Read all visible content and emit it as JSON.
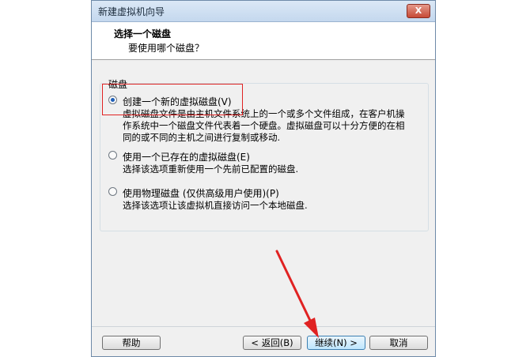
{
  "window": {
    "title": "新建虚拟机向导",
    "close_label": "X"
  },
  "header": {
    "title": "选择一个磁盘",
    "subtitle": "要使用哪个磁盘？"
  },
  "group": {
    "legend": "磁盘"
  },
  "options": [
    {
      "label": "创建一个新的虚拟磁盘(V)",
      "selected": true,
      "desc": [
        "虚拟磁盘文件是由主机文件系统上的一个或多个文件组成，在客户机操",
        "作系统中一个磁盘文件代表着一个硬盘。虚拟磁盘可以十分方便的在相",
        "同的或不同的主机之间进行复制或移动."
      ]
    },
    {
      "label": "使用一个已存在的虚拟磁盘(E)",
      "selected": false,
      "desc": [
        "选择该选项重新使用一个先前已配置的磁盘."
      ]
    },
    {
      "label": "使用物理磁盘 (仅供高级用户使用)(P)",
      "selected": false,
      "desc": [
        "选择该选项让该虚拟机直接访问一个本地磁盘."
      ]
    }
  ],
  "buttons": {
    "help": "帮助",
    "back": "< 返回(B)",
    "next": "继续(N) >",
    "cancel": "取消"
  },
  "annotation": {
    "highlight_color": "#e02222",
    "arrow_color": "#e02222"
  }
}
